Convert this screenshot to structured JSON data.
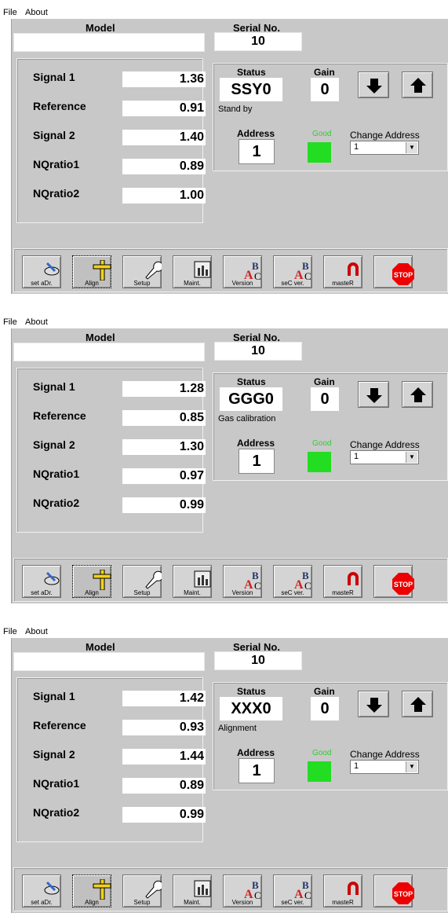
{
  "menu": {
    "file": "File",
    "about": "About"
  },
  "labels": {
    "model": "Model",
    "serial": "Serial No.",
    "status": "Status",
    "gain": "Gain",
    "address": "Address",
    "good": "Good",
    "change_address": "Change Address"
  },
  "colors": {
    "panel": "#c8c8c8",
    "good_indicator": "#22dd22",
    "good_text": "#33cc33"
  },
  "toolbar": [
    {
      "icon": "hand-pen-icon",
      "label": "set aDr."
    },
    {
      "icon": "ruler-cross-icon",
      "label": "Align"
    },
    {
      "icon": "wrench-icon",
      "label": "Setup"
    },
    {
      "icon": "chart-icon",
      "label": "Maint."
    },
    {
      "icon": "abc-icon",
      "label": "Version"
    },
    {
      "icon": "abc-icon",
      "label": "seC ver."
    },
    {
      "icon": "magnet-icon",
      "label": "masteR"
    },
    {
      "icon": "stop-icon",
      "label": "STOP"
    }
  ],
  "windows": [
    {
      "model": "",
      "serial": "10",
      "signals": [
        {
          "label": "Signal 1",
          "value": "1.36"
        },
        {
          "label": "Reference",
          "value": "0.91"
        },
        {
          "label": "Signal 2",
          "value": "1.40"
        },
        {
          "label": "NQratio1",
          "value": "0.89"
        },
        {
          "label": "NQratio2",
          "value": "1.00"
        }
      ],
      "status_code": "SSY0",
      "gain": "0",
      "status_text": "Stand by",
      "address": "1",
      "change_address_value": "1"
    },
    {
      "model": "",
      "serial": "10",
      "signals": [
        {
          "label": "Signal 1",
          "value": "1.28"
        },
        {
          "label": "Reference",
          "value": "0.85"
        },
        {
          "label": "Signal 2",
          "value": "1.30"
        },
        {
          "label": "NQratio1",
          "value": "0.97"
        },
        {
          "label": "NQratio2",
          "value": "0.99"
        }
      ],
      "status_code": "GGG0",
      "gain": "0",
      "status_text": "Gas calibration",
      "address": "1",
      "change_address_value": "1"
    },
    {
      "model": "",
      "serial": "10",
      "signals": [
        {
          "label": "Signal 1",
          "value": "1.42"
        },
        {
          "label": "Reference",
          "value": "0.93"
        },
        {
          "label": "Signal 2",
          "value": "1.44"
        },
        {
          "label": "NQratio1",
          "value": "0.89"
        },
        {
          "label": "NQratio2",
          "value": "0.99"
        }
      ],
      "status_code": "XXX0",
      "gain": "0",
      "status_text": "Alignment",
      "address": "1",
      "change_address_value": "1"
    }
  ]
}
